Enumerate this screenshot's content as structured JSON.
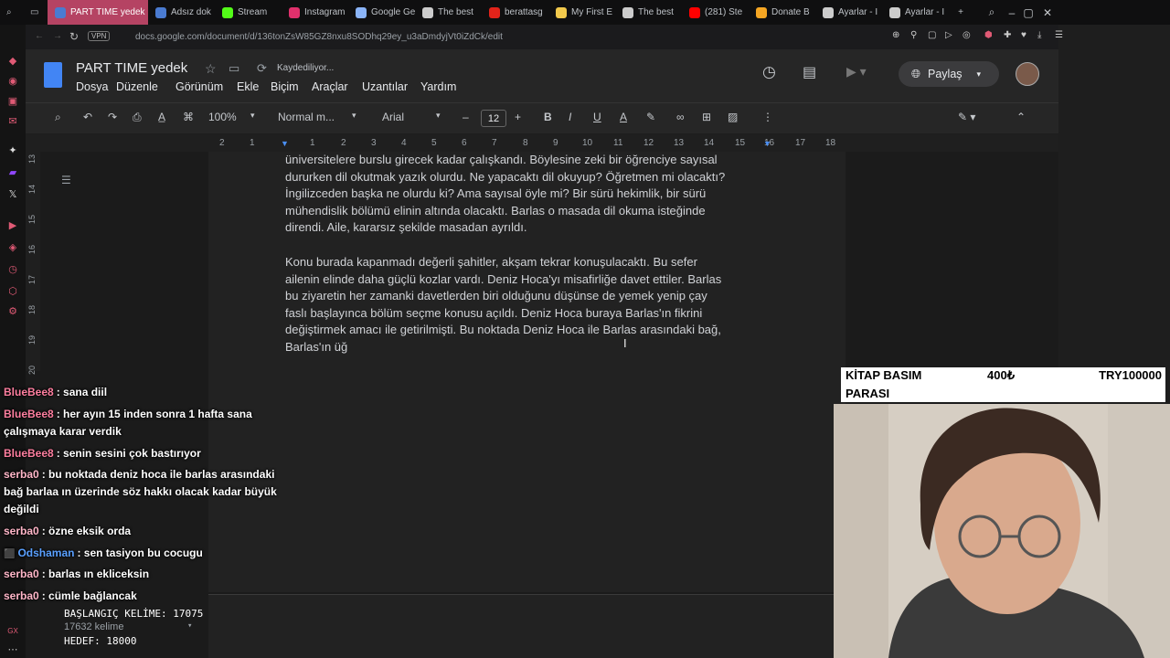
{
  "browser": {
    "tabs": [
      {
        "label": "PART TIME yedek",
        "icon": "docs-icon",
        "color": "#4a7bd1",
        "active": true
      },
      {
        "label": "Adsız dok",
        "icon": "docs-icon",
        "color": "#4a7bd1"
      },
      {
        "label": "Stream",
        "icon": "kick-icon",
        "color": "#53fc18"
      },
      {
        "label": "Instagram",
        "icon": "instagram-icon",
        "color": "#e1306c"
      },
      {
        "label": "Google Ge",
        "icon": "gemini-icon",
        "color": "#8ab4f8"
      },
      {
        "label": "The best",
        "icon": "site-icon",
        "color": "#cccccc"
      },
      {
        "label": "berattasg",
        "icon": "bi-icon",
        "color": "#e2231a"
      },
      {
        "label": "My First E",
        "icon": "site-icon",
        "color": "#f2c94c"
      },
      {
        "label": "The best",
        "icon": "site-icon",
        "color": "#cccccc"
      },
      {
        "label": "(281) Ste",
        "icon": "youtube-icon",
        "color": "#ff0000"
      },
      {
        "label": "Donate B",
        "icon": "donate-icon",
        "color": "#f5a623"
      },
      {
        "label": "Ayarlar - I",
        "icon": "settings-icon",
        "color": "#cccccc"
      },
      {
        "label": "Ayarlar - I",
        "icon": "settings-icon",
        "color": "#cccccc"
      }
    ],
    "url": "docs.google.com/document/d/136tonZsW85GZ8nxu8SODhq29ey_u3aDmdyjVt0iZdCk/edit",
    "vpn_label": "VPN"
  },
  "docs": {
    "title": "PART TIME  yedek",
    "saving_status": "Kaydediliyor...",
    "menu": [
      "Dosya",
      "Düzenle",
      "Görünüm",
      "Ekle",
      "Biçim",
      "Araçlar",
      "Uzantılar",
      "Yardım"
    ],
    "share_label": "Paylaş",
    "toolbar": {
      "zoom": "100%",
      "style": "Normal m...",
      "font": "Arial",
      "font_size": "12"
    },
    "ruler_ticks": [
      "2",
      "1",
      "1",
      "2",
      "3",
      "4",
      "5",
      "6",
      "7",
      "8",
      "9",
      "10",
      "11",
      "12",
      "13",
      "14",
      "15",
      "16",
      "17",
      "18"
    ],
    "vruler_ticks": [
      "13",
      "14",
      "15",
      "16",
      "17",
      "18",
      "19",
      "20"
    ],
    "paragraphs": [
      {
        "lines": [
          "üniversitelere burslu girecek kadar çalışkandı. Böylesine zeki bir öğrenciye sayısal",
          "dururken dil okutmak yazık olurdu. Ne yapacaktı dil okuyup? Öğretmen mi olacaktı?",
          "İngilizceden başka ne olurdu ki? Ama sayısal öyle mi? Bir sürü hekimlik, bir sürü",
          "mühendislik bölümü elinin altında olacaktı. Barlas o masada dil okuma isteğinde",
          "direndi. Aile, kararsız şekilde masadan ayrıldı."
        ]
      },
      {
        "lines": [
          "Konu burada kapanmadı değerli şahitler, akşam tekrar konuşulacaktı. Bu sefer",
          "ailenin elinde daha güçlü kozlar vardı. Deniz Hoca'yı misafirliğe davet ettiler. Barlas",
          "bu ziyaretin her zamanki davetlerden biri olduğunu düşünse de yemek yenip çay",
          "faslı başlayınca bölüm seçme konusu açıldı. Deniz Hoca buraya Barlas'ın fikrini",
          "değiştirmek amacı ile getirilmişti. Bu noktada Deniz Hoca ile Barlas arasındaki bağ,",
          "Barlas'ın üğ"
        ]
      }
    ]
  },
  "chat": [
    {
      "user": "BlueBee8",
      "user_color": "#ff7fa0",
      "text": ": sana diil"
    },
    {
      "user": "BlueBee8",
      "user_color": "#ff7fa0",
      "text": ": her ayın 15 inden sonra 1 hafta sana çalışmaya karar verdik"
    },
    {
      "user": "BlueBee8",
      "user_color": "#ff7fa0",
      "text": ": senin sesini çok bastırıyor"
    },
    {
      "user": "serba0",
      "user_color": "#ffb6c8",
      "text": ": bu noktada deniz hoca ile barlas arasındaki bağ barlaa ın üzerinde söz hakkı olacak kadar büyük değildi"
    },
    {
      "user": "serba0",
      "user_color": "#ffb6c8",
      "text": ": özne eksik orda"
    },
    {
      "user": "Odshaman",
      "user_color": "#5aa0ff",
      "text": ": sen tasiyon bu cocugu"
    },
    {
      "user": "serba0",
      "user_color": "#ffb6c8",
      "text": ": barlas ın ekliceksin"
    },
    {
      "user": "serba0",
      "user_color": "#ffb6c8",
      "text": ": cümle bağlancak"
    }
  ],
  "counter": {
    "start": "BAŞLANGIÇ KELİME: 17075",
    "current": "17632 kelime",
    "target": "HEDEF: 18000"
  },
  "book": {
    "label_line1": "KİTAP BASIM",
    "label_line2": "PARASI",
    "current": "400₺",
    "goal": "TRY100000"
  }
}
